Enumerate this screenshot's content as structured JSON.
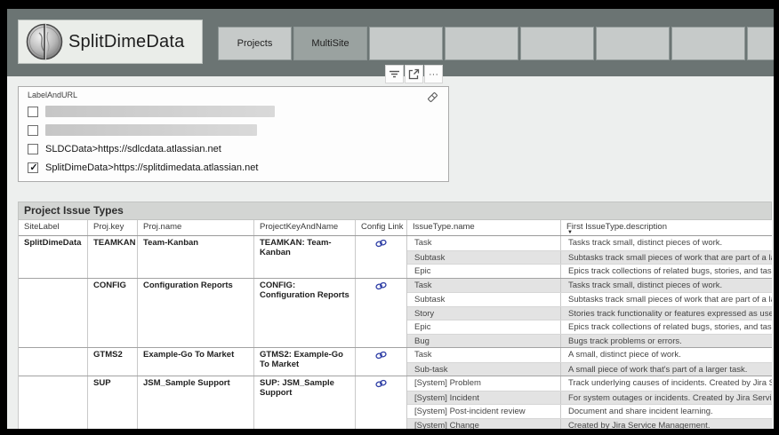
{
  "header": {
    "logo_text": "SplitDimeData",
    "tabs": [
      {
        "label": "Projects",
        "selected": false
      },
      {
        "label": "MultiSite",
        "selected": true
      },
      {
        "label": "",
        "selected": false
      },
      {
        "label": "",
        "selected": false
      },
      {
        "label": "",
        "selected": false
      },
      {
        "label": "",
        "selected": false
      },
      {
        "label": "",
        "selected": false
      },
      {
        "label": "",
        "selected": false
      }
    ]
  },
  "toolbar": {
    "more_label": "···",
    "icons": [
      "filter-icon",
      "popout-icon",
      "more-options-icon"
    ]
  },
  "slicer": {
    "title": "LabelAndURL",
    "items": [
      {
        "label": "",
        "checked": false,
        "redacted": true
      },
      {
        "label": "",
        "checked": false,
        "redacted": true
      },
      {
        "label": "SLDCData>https://sdlcdata.atlassian.net",
        "checked": false,
        "redacted": false
      },
      {
        "label": "SplitDimeData>https://splitdimedata.atlassian.net",
        "checked": true,
        "redacted": false
      }
    ]
  },
  "table": {
    "title": "Project Issue Types",
    "columns": [
      "SiteLabel",
      "Proj.key",
      "Proj.name",
      "ProjectKeyAndName",
      "Config Link",
      "IssueType.name",
      "First IssueType.description"
    ],
    "sorted_column": "First IssueType.description",
    "sort_direction": "desc",
    "groups": [
      {
        "site": "SplitDimeData",
        "key": "TEAMKAN",
        "name": "Team-Kanban",
        "key_and_name": "TEAMKAN: Team-Kanban",
        "issues": [
          {
            "name": "Task",
            "description": "Tasks track small, distinct pieces of work."
          },
          {
            "name": "Subtask",
            "description": "Subtasks track small pieces of work that are part of a larger task."
          },
          {
            "name": "Epic",
            "description": "Epics track collections of related bugs, stories, and tasks."
          }
        ]
      },
      {
        "site": "",
        "key": "CONFIG",
        "name": "Configuration Reports",
        "key_and_name": "CONFIG: Configuration Reports",
        "issues": [
          {
            "name": "Task",
            "description": "Tasks track small, distinct pieces of work."
          },
          {
            "name": "Subtask",
            "description": "Subtasks track small pieces of work that are part of a larger task."
          },
          {
            "name": "Story",
            "description": "Stories track functionality or features expressed as user goals."
          },
          {
            "name": "Epic",
            "description": "Epics track collections of related bugs, stories, and tasks."
          },
          {
            "name": "Bug",
            "description": "Bugs track problems or errors."
          }
        ]
      },
      {
        "site": "",
        "key": "GTMS2",
        "name": "Example-Go To Market",
        "key_and_name": "GTMS2: Example-Go To Market",
        "issues": [
          {
            "name": "Task",
            "description": "A small, distinct piece of work."
          },
          {
            "name": "Sub-task",
            "description": "A small piece of work that's part of a larger task."
          }
        ]
      },
      {
        "site": "",
        "key": "SUP",
        "name": "JSM_Sample Support",
        "key_and_name": "SUP: JSM_Sample Support",
        "issues": [
          {
            "name": "[System] Problem",
            "description": "Track underlying causes of incidents. Created by Jira Service Management."
          },
          {
            "name": "[System] Incident",
            "description": "For system outages or incidents. Created by Jira Service Management."
          },
          {
            "name": "[System] Post-incident review",
            "description": "Document and share incident learning."
          },
          {
            "name": "[System] Change",
            "description": "Created by Jira Service Management."
          }
        ]
      }
    ]
  },
  "colors": {
    "frame": "#000000",
    "page_bg": "#edefee",
    "header_band": "#6b7473",
    "tab_bg": "#c6cac9",
    "tab_selected_bg": "#9aa2a0",
    "alt_row_bg": "#e3e3e3",
    "link_icon_blue": "#2f3fa6",
    "section_title_bg": "#d3d5d3"
  }
}
